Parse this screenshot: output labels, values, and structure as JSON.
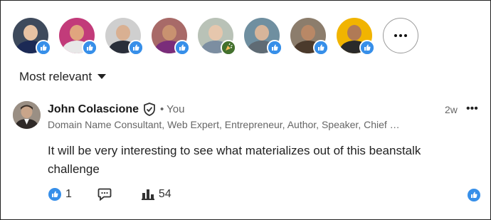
{
  "reactors": {
    "people": [
      {
        "bg": "#3e4a5c",
        "skin": "#e7c2a3",
        "shirt": "#1c2a55",
        "reaction": "like"
      },
      {
        "bg": "#c23b7a",
        "skin": "#e0a57e",
        "shirt": "#e8e8e8",
        "reaction": "like"
      },
      {
        "bg": "#cfcfcf",
        "skin": "#d9b092",
        "shirt": "#2a2f3a",
        "reaction": "like"
      },
      {
        "bg": "#a86a68",
        "skin": "#c99270",
        "shirt": "#7a2d7a",
        "reaction": "like"
      },
      {
        "bg": "#b9c2b7",
        "skin": "#e6c7ad",
        "shirt": "#7c8ea1",
        "reaction": "celebrate"
      },
      {
        "bg": "#6f8fa0",
        "skin": "#d7b59a",
        "shirt": "#5f6b74",
        "reaction": "like"
      },
      {
        "bg": "#8c7d6c",
        "skin": "#b98866",
        "shirt": "#4b3a2c",
        "reaction": "like"
      },
      {
        "bg": "#f1b400",
        "skin": "#b07a56",
        "shirt": "#2a2a2a",
        "reaction": "like"
      }
    ],
    "more_icon": "ellipsis-icon"
  },
  "sort": {
    "label": "Most relevant",
    "icon": "caret-down-icon"
  },
  "comment": {
    "author": "John Colascione",
    "verified_icon": "verified-shield-icon",
    "you_label": "• You",
    "headline": "Domain Name Consultant, Web Expert, Entrepreneur, Author, Speaker, Chief …",
    "time": "2w",
    "overflow": "•••",
    "text": "It will be very interesting to see what materializes out of this beanstalk challenge",
    "likes": "1",
    "impressions": "54"
  },
  "colors": {
    "like_blue": "#378fe9",
    "celebrate_green": "#44712e",
    "text_dark": "#191919",
    "meta_gray": "#666666"
  }
}
